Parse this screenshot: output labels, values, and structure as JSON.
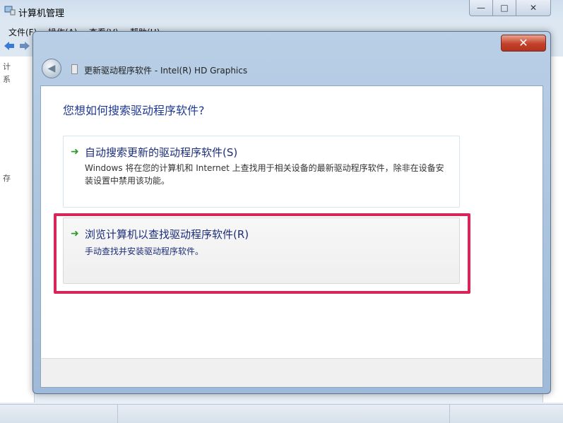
{
  "background_window": {
    "title": "计算机管理",
    "menu": [
      "文件(F)",
      "操作(A)",
      "查看(V)",
      "帮助(H)"
    ],
    "caption_buttons": {
      "minimize": "—",
      "maximize": "□",
      "close": "✕"
    },
    "tree_marks": [
      "计",
      "系",
      "存"
    ]
  },
  "dialog": {
    "close_symbol": "✕",
    "back_symbol": "◀",
    "title": "更新驱动程序软件 - Intel(R) HD Graphics",
    "question": "您想如何搜索驱动程序软件?",
    "options": [
      {
        "arrow": "➜",
        "title": "自动搜索更新的驱动程序软件(S)",
        "description": "Windows 将在您的计算机和 Internet 上查找用于相关设备的最新驱动程序软件，除非在设备安装设置中禁用该功能。"
      },
      {
        "arrow": "➜",
        "title": "浏览计算机以查找驱动程序软件(R)",
        "description": "手动查找并安装驱动程序软件。"
      }
    ]
  },
  "colors": {
    "highlight": "#d8265a",
    "link_text": "#1c2d7a",
    "arrow_green": "#2e9a2e"
  },
  "icons": [
    "computer-management-icon",
    "back-arrow-icon",
    "display-device-icon",
    "green-arrow-icon",
    "close-icon"
  ]
}
